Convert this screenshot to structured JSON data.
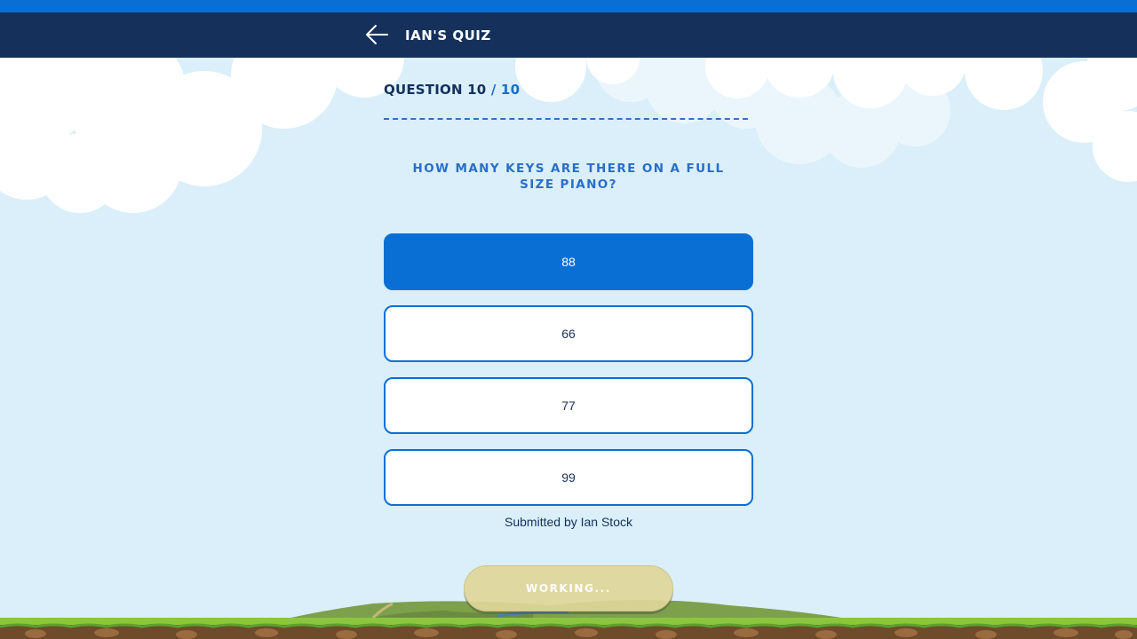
{
  "header": {
    "title": "Ian's Quiz",
    "back_icon": "arrow-left-icon"
  },
  "quiz": {
    "question_label": "Question 10",
    "question_total": " / 10",
    "question_text": "How many keys are there on a full size piano?",
    "answers": [
      {
        "label": "88",
        "selected": true
      },
      {
        "label": "66",
        "selected": false
      },
      {
        "label": "77",
        "selected": false
      },
      {
        "label": "99",
        "selected": false
      }
    ],
    "submitted_by": "Submitted by Ian Stock",
    "action_button": "Working..."
  },
  "colors": {
    "top_stripe": "#0a6fd4",
    "header_bg": "#15315b",
    "accent": "#0a6fd4",
    "question_text": "#2a6ec9",
    "sky": "#daeffa",
    "button_disabled": "#e0d698"
  }
}
